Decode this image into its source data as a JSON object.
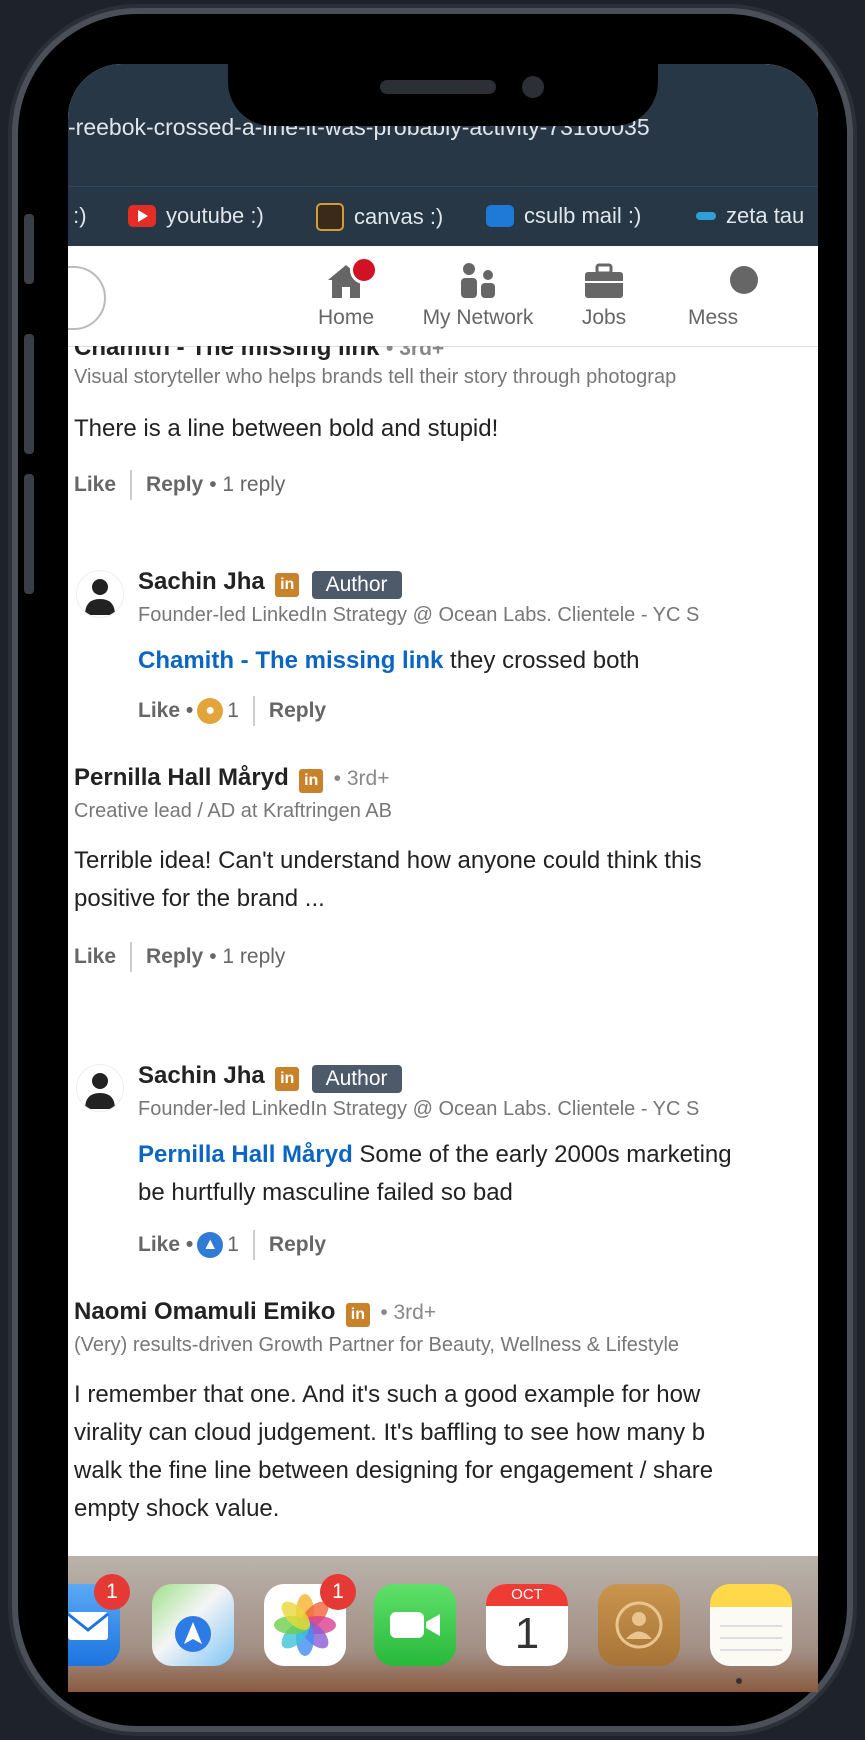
{
  "browser": {
    "url": "-reebok-crossed-a-line-it-was-probably-activity-73160035",
    "bookmarks": [
      {
        "label": "s :)",
        "icon": "bookmark-icon"
      },
      {
        "label": "youtube :)",
        "icon": "youtube-icon"
      },
      {
        "label": "canvas :)",
        "icon": "canvas-icon"
      },
      {
        "label": "csulb mail :)",
        "icon": "outlook-icon"
      },
      {
        "label": "zeta tau",
        "icon": "bookmark-icon"
      }
    ]
  },
  "nav": {
    "items": [
      {
        "label": "Home",
        "icon": "home-icon"
      },
      {
        "label": "My Network",
        "icon": "network-icon"
      },
      {
        "label": "Jobs",
        "icon": "briefcase-icon"
      },
      {
        "label": "Mess",
        "icon": "messaging-icon"
      }
    ]
  },
  "comments": [
    {
      "name": "Chamith - The missing link",
      "degree": "• 3rd+",
      "headline": "Visual storyteller who helps brands tell their story through photograp",
      "text": "There is a line between bold and stupid!",
      "like": "Like",
      "reply": "Reply",
      "reply_count": "• 1 reply"
    },
    {
      "name": "Sachin Jha",
      "badge": "in",
      "author": "Author",
      "headline": "Founder-led LinkedIn Strategy @ Ocean Labs. Clientele - YC S",
      "mention": "Chamith - The missing link",
      "text": " they crossed both",
      "like": "Like •",
      "reactions": "1",
      "reply": "Reply"
    },
    {
      "name": "Pernilla Hall Måryd",
      "badge": "in",
      "degree": "• 3rd+",
      "headline": "Creative lead / AD at Kraftringen AB",
      "text_line1": "Terrible idea! Can't understand how anyone could think this",
      "text_line2": "positive for the brand ...",
      "like": "Like",
      "reply": "Reply",
      "reply_count": "• 1 reply"
    },
    {
      "name": "Sachin Jha",
      "badge": "in",
      "author": "Author",
      "headline": "Founder-led LinkedIn Strategy @ Ocean Labs. Clientele - YC S",
      "mention": "Pernilla Hall Måryd",
      "text_line1": " Some of the early 2000s marketing",
      "text_line2": "be hurtfully masculine failed so bad",
      "like": "Like •",
      "reactions": "1",
      "reply": "Reply"
    },
    {
      "name": "Naomi Omamuli Emiko",
      "badge": "in",
      "degree": "• 3rd+",
      "headline": "(Very) results-driven Growth Partner for Beauty, Wellness & Lifestyle",
      "text_line1": "I remember that one. And it's such a good example for how",
      "text_line2": "virality can cloud judgement. It's baffling to see how many b",
      "text_line3": "walk the fine line between designing for engagement / share",
      "text_line4": "empty shock value."
    }
  ],
  "dock": {
    "apps": [
      {
        "name": "mail",
        "badge": "1"
      },
      {
        "name": "maps",
        "badge": ""
      },
      {
        "name": "photos",
        "badge": "1"
      },
      {
        "name": "facetime",
        "badge": ""
      },
      {
        "name": "calendar",
        "badge": ""
      },
      {
        "name": "contacts",
        "badge": ""
      },
      {
        "name": "notes",
        "badge": ""
      }
    ],
    "calendar_month": "OCT",
    "calendar_day": "1"
  },
  "colors": {
    "linkedin_blue": "#0a66c2",
    "url_bar": "#283746",
    "author_badge": "#4d5a6a",
    "notification_red": "#d11124"
  }
}
